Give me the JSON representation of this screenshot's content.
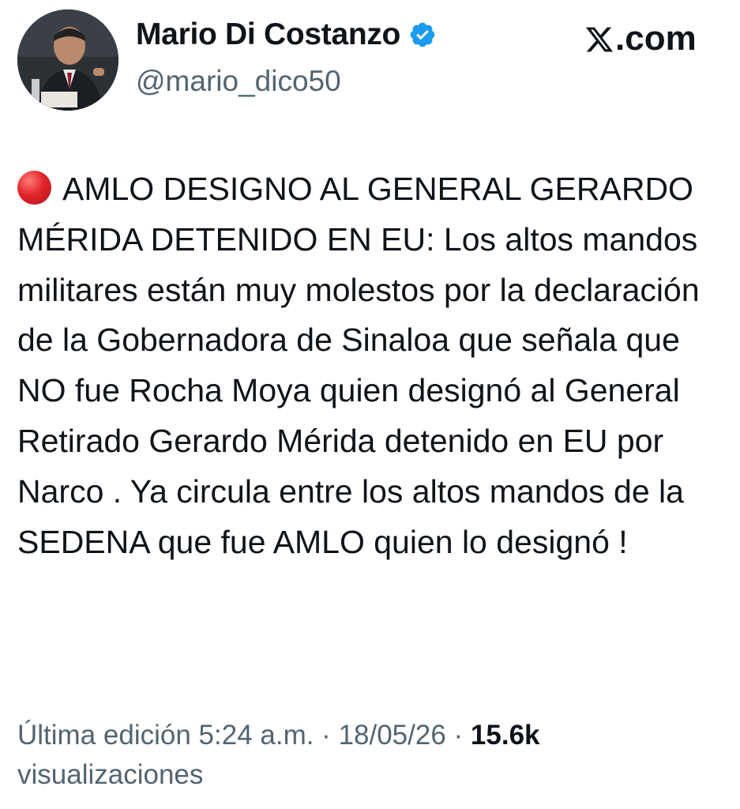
{
  "author": {
    "display_name": "Mario Di Costanzo",
    "handle": "@mario_dico50",
    "verified": true,
    "avatar_icon": "profile-photo"
  },
  "source": {
    "label": ".com",
    "logo_icon": "x-logo-icon"
  },
  "tweet": {
    "emoji": "red-circle-icon",
    "text": "AMLO DESIGNO AL GENERAL GERARDO MÉRIDA DETENIDO EN EU: Los altos mandos militares están muy molestos por la declaración de la Gobernadora de Sinaloa que señala que NO fue Rocha Moya quien designó al General Retirado Gerardo Mérida detenido en EU por Narco . Ya circula entre los altos mandos de la SEDENA que fue AMLO quien lo designó !"
  },
  "meta": {
    "edit_label": "Última edición 5:24 a.m.",
    "separator": " · ",
    "date": "18/05/26",
    "views_count": "15.6k",
    "views_label": "visualizaciones"
  },
  "colors": {
    "verified": "#1d9bf0",
    "secondary_text": "#536471",
    "primary_text": "#0f1419",
    "emoji_red": "#e0252a"
  }
}
